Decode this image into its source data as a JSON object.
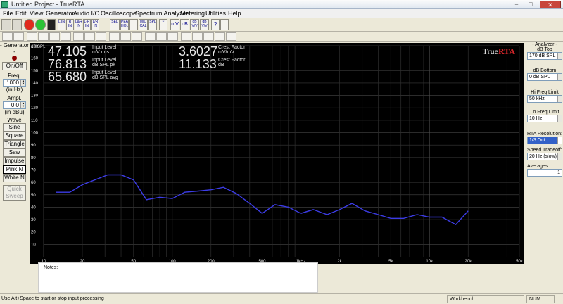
{
  "window": {
    "title": "Untitled Project - TrueRTA",
    "min": "−",
    "max": "□",
    "close": "✕"
  },
  "menu": [
    "File",
    "Edit",
    "View",
    "Generator",
    "Audio I/O",
    "Oscilloscope",
    "Spectrum Analyzer",
    "Metering",
    "Utilities",
    "Help"
  ],
  "toolbar": {
    "buttons": [
      "L IN",
      "R IN",
      "L&R IN",
      "L-R IN",
      "L/R IN",
      "SEL",
      "PEAK HOLD",
      "MIC CAL",
      "SPL",
      "~",
      "mV",
      "dB",
      "dB V/V",
      "dB V/V",
      "?"
    ]
  },
  "generator": {
    "title": "- Generator -",
    "onoff": "On/Off",
    "freq_label": "Freq.",
    "freq_value": "1000",
    "freq_unit": "(in Hz)",
    "ampl_label": "Ampl.",
    "ampl_value": "0.0",
    "ampl_unit": "(in dBu)",
    "wave_label": "Wave",
    "waves": [
      "Sine",
      "Square",
      "Triangle",
      "Saw",
      "Impulse",
      "Pink N",
      "White N"
    ],
    "selected_wave": "Pink N",
    "quick_sweep": "Quick Sweep"
  },
  "readouts": {
    "r1": {
      "value": "47.105",
      "label1": "Input Level",
      "label2": "mV rms"
    },
    "r2": {
      "value": "76.813",
      "label1": "Input Level",
      "label2": "dB SPL pk"
    },
    "r3": {
      "value": "65.680",
      "label1": "Input Level",
      "label2": "dB SPL avg"
    },
    "r4": {
      "value": "3.6027",
      "label1": "Crest Factor",
      "label2": "mV/mV"
    },
    "r5": {
      "value": "11.133",
      "label1": "Crest Factor",
      "label2": "dB"
    }
  },
  "logo": {
    "part1": "True",
    "part2": "RTA"
  },
  "chart_data": {
    "type": "line",
    "ylabel": "dB SPL",
    "ylim": [
      0,
      170
    ],
    "yticks": [
      170,
      160,
      150,
      140,
      130,
      120,
      110,
      100,
      90,
      80,
      70,
      60,
      50,
      40,
      30,
      20,
      10
    ],
    "xscale": "log",
    "xlim": [
      10,
      50000
    ],
    "xticks": [
      {
        "v": 10,
        "label": "10"
      },
      {
        "v": 20,
        "label": "20"
      },
      {
        "v": 50,
        "label": "50"
      },
      {
        "v": 100,
        "label": "100"
      },
      {
        "v": 200,
        "label": "200"
      },
      {
        "v": 500,
        "label": "500"
      },
      {
        "v": 1000,
        "label": "1kHz"
      },
      {
        "v": 2000,
        "label": "2k"
      },
      {
        "v": 5000,
        "label": "5k"
      },
      {
        "v": 10000,
        "label": "10k"
      },
      {
        "v": 20000,
        "label": "20k"
      },
      {
        "v": 50000,
        "label": "50k"
      }
    ],
    "grid": true,
    "series": [
      {
        "x": [
          12.5,
          16,
          20,
          25,
          31.5,
          40,
          50,
          63,
          80,
          100,
          125,
          160,
          200,
          250,
          315,
          400,
          500,
          630,
          800,
          1000,
          1250,
          1600,
          2000,
          2500,
          3150,
          4000,
          5000,
          6300,
          8000,
          10000,
          12500,
          16000,
          20000
        ],
        "y": [
          52,
          52,
          58,
          62,
          66,
          66,
          62,
          46,
          48,
          47,
          52,
          53,
          54,
          56,
          51,
          43,
          35,
          42,
          40,
          35,
          38,
          34,
          38,
          43,
          37,
          34,
          31,
          31,
          34,
          32,
          32,
          26,
          37
        ]
      }
    ],
    "meter_level": 66,
    "meter_peak": 77
  },
  "notes_label": "Notes:",
  "analyzer": {
    "title": "- Analyzer -",
    "top_label": "dB Top",
    "top_value": "170 dB SPL",
    "bottom_label": "dB Bottom",
    "bottom_value": "0 dB SPL",
    "hi_label": "Hi Freq Limit",
    "hi_value": "50 kHz",
    "lo_label": "Lo Freq Limit",
    "lo_value": "10 Hz",
    "res_label": "RTA Resolution:",
    "res_value": "1/3 Oct.",
    "speed_label": "Speed Tradeoff:",
    "speed_value": "20 Hz (slow)",
    "avg_label": "Averages:",
    "avg_value": "1"
  },
  "status": {
    "message": "Use Alt+Space to start or stop input processing",
    "workbench": "Workbench",
    "num": "NUM"
  }
}
